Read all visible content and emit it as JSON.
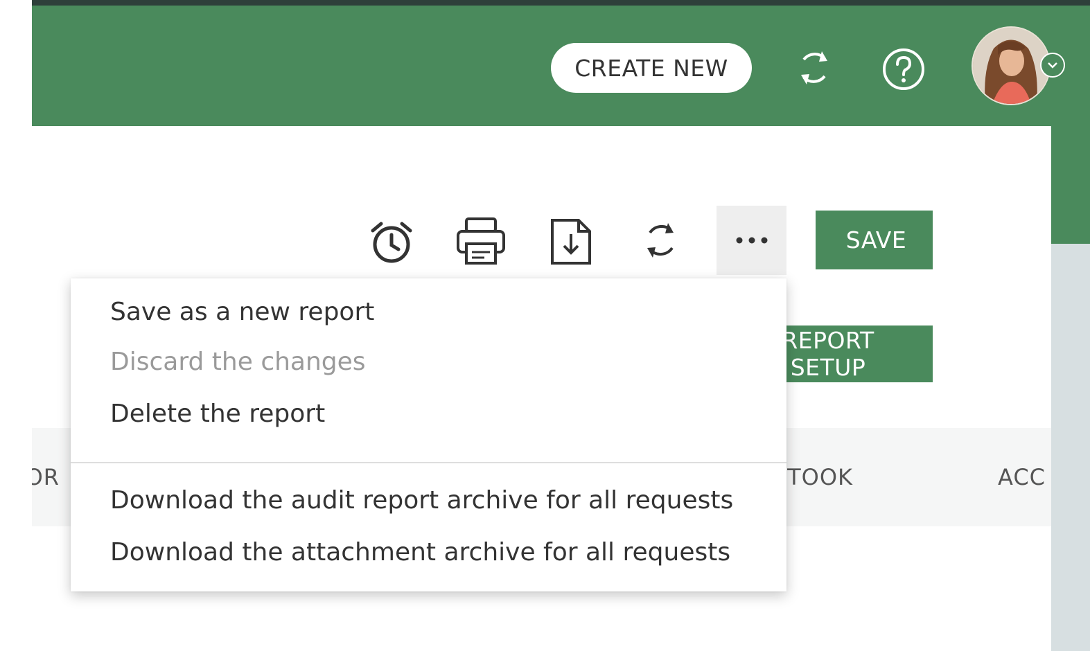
{
  "header": {
    "create_new_label": "CREATE NEW",
    "icons": [
      "refresh-icon",
      "help-icon",
      "avatar",
      "chevron-down-icon"
    ]
  },
  "toolbar": {
    "icons": [
      "alarm-clock-icon",
      "print-icon",
      "download-icon",
      "refresh-icon",
      "more-icon"
    ],
    "save_label": "SAVE",
    "report_setup_label": "REPORT SETUP"
  },
  "table": {
    "headers": [
      "OR",
      "N TOOK",
      "ACC"
    ]
  },
  "dropdown_menu": {
    "items": [
      {
        "label": "Save as a new report",
        "enabled": true
      },
      {
        "label": "Discard the changes",
        "enabled": false
      },
      {
        "label": "Delete the report",
        "enabled": true
      },
      {
        "label": "Download the audit report archive for all requests",
        "enabled": true
      },
      {
        "label": "Download the attachment archive for all requests",
        "enabled": true
      }
    ]
  },
  "colors": {
    "brand_green": "#4a8a5c",
    "top_edge": "#2e3f3a",
    "side_gray": "#d7dfe1"
  }
}
